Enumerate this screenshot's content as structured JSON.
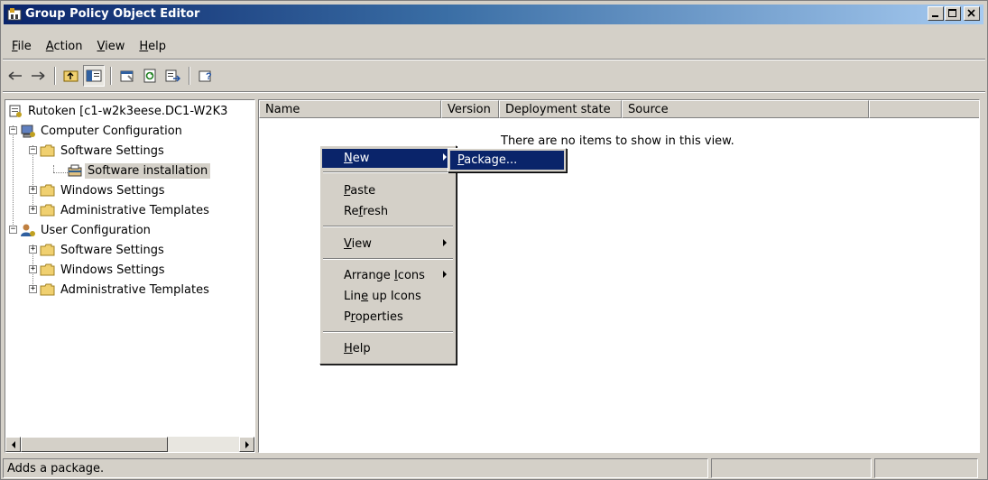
{
  "window": {
    "title": "Group Policy Object Editor",
    "controls": {
      "minimize": "_",
      "maximize": "□",
      "close": "×"
    }
  },
  "menubar": [
    {
      "label": "File",
      "accel": "F",
      "rest": "ile"
    },
    {
      "label": "Action",
      "accel": "A",
      "rest": "ction"
    },
    {
      "label": "View",
      "accel": "V",
      "rest": "iew"
    },
    {
      "label": "Help",
      "accel": "H",
      "rest": "elp"
    }
  ],
  "toolbar": {
    "icons": [
      "back-arrow-icon",
      "forward-arrow-icon",
      "up-folder-icon",
      "show-tree-icon",
      "properties-icon",
      "refresh-icon",
      "export-list-icon",
      "help-icon"
    ]
  },
  "tree": {
    "root": "Rutoken [c1-w2k3eese.DC1-W2K3",
    "computer_config": "Computer Configuration",
    "cc_software_settings": "Software Settings",
    "cc_software_installation": "Software installation",
    "cc_windows_settings": "Windows Settings",
    "cc_admin_templates": "Administrative Templates",
    "user_config": "User Configuration",
    "uc_software_settings": "Software Settings",
    "uc_windows_settings": "Windows Settings",
    "uc_admin_templates": "Administrative Templates"
  },
  "list": {
    "columns": [
      "Name",
      "Version",
      "Deployment state",
      "Source"
    ],
    "empty_message": "There are no items to show in this view."
  },
  "context_menu": {
    "new": {
      "accel": "N",
      "rest": "ew"
    },
    "paste": {
      "accel": "P",
      "rest": "aste"
    },
    "refresh": {
      "pre": "Re",
      "accel": "f",
      "rest": "resh"
    },
    "view": {
      "accel": "V",
      "rest": "iew"
    },
    "arrange_icons": {
      "pre": "Arrange ",
      "accel": "I",
      "rest": "cons"
    },
    "line_up_icons": {
      "pre": "Lin",
      "accel": "e",
      "rest": " up Icons"
    },
    "properties": {
      "pre": "P",
      "accel": "r",
      "rest": "operties"
    },
    "help": {
      "accel": "H",
      "rest": "elp"
    }
  },
  "submenu": {
    "accel": "P",
    "rest": "ackage..."
  },
  "statusbar": {
    "text": "Adds a package."
  },
  "colors": {
    "title_start": "#0a246a",
    "title_end": "#a6caf0",
    "highlight": "#0a246a",
    "face": "#d4d0c8"
  }
}
